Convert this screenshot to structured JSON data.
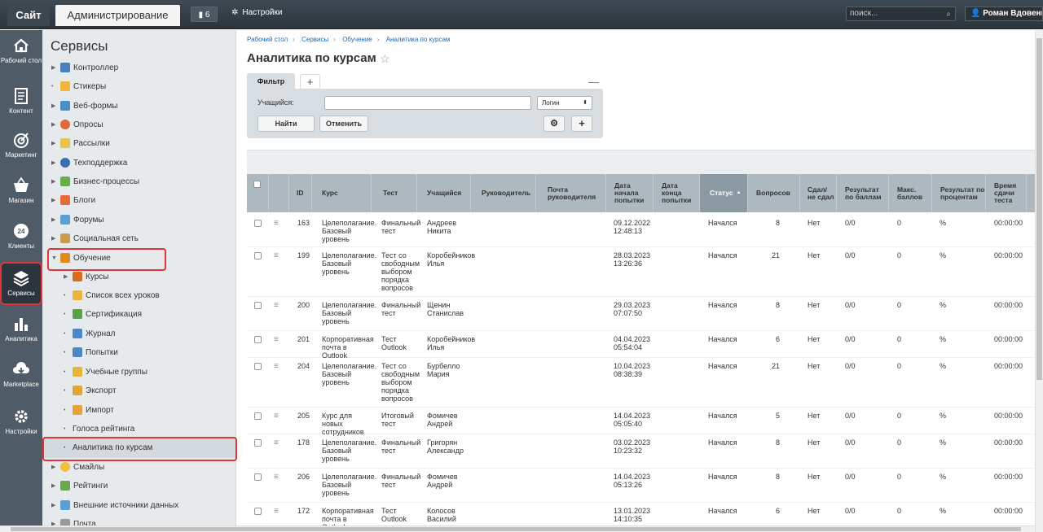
{
  "topbar": {
    "site_tab": "Сайт",
    "admin_tab": "Администрирование",
    "notifications_count": "6",
    "settings_label": "Настройки",
    "search_placeholder": "поиск...",
    "user_name": "Роман Вдовенко"
  },
  "leftnav": [
    {
      "label": "Рабочий стол",
      "icon": "home-icon"
    },
    {
      "label": "Контент",
      "icon": "document-icon"
    },
    {
      "label": "Маркетинг",
      "icon": "target-icon"
    },
    {
      "label": "Магазин",
      "icon": "cart-icon"
    },
    {
      "label": "Клиенты",
      "icon": "clients-icon"
    },
    {
      "label": "Сервисы",
      "icon": "layers-icon"
    },
    {
      "label": "Аналитика",
      "icon": "bar-chart-icon"
    },
    {
      "label": "Marketplace",
      "icon": "cloud-download-icon"
    },
    {
      "label": "Настройки",
      "icon": "gear-icon"
    }
  ],
  "tree": {
    "title": "Сервисы",
    "items": [
      {
        "label": "Контроллер",
        "color": "#4a7fc1"
      },
      {
        "label": "Стикеры",
        "color": "#f2b53c"
      },
      {
        "label": "Веб-формы",
        "color": "#4a90c8"
      },
      {
        "label": "Опросы",
        "color": "#e0693a"
      },
      {
        "label": "Рассылки",
        "color": "#e3c452"
      },
      {
        "label": "Техподдержка",
        "color": "#3b6fb5"
      },
      {
        "label": "Бизнес-процессы",
        "color": "#6ba84f"
      },
      {
        "label": "Блоги",
        "color": "#e56a3a"
      },
      {
        "label": "Форумы",
        "color": "#5c9fd5"
      },
      {
        "label": "Социальная сеть",
        "color": "#c79c4f"
      },
      {
        "label": "Обучение",
        "color": "#e08a1e"
      }
    ],
    "sub_items": [
      {
        "label": "Курсы",
        "color": "#d86b1e"
      },
      {
        "label": "Список всех уроков",
        "color": "#e6b53a"
      },
      {
        "label": "Сертификация",
        "color": "#5aa04b"
      },
      {
        "label": "Журнал",
        "color": "#4f86c9"
      },
      {
        "label": "Попытки",
        "color": "#4f86c9"
      },
      {
        "label": "Учебные группы",
        "color": "#e6b53a"
      },
      {
        "label": "Экспорт",
        "color": "#e6a23a"
      },
      {
        "label": "Импорт",
        "color": "#e6a23a"
      },
      {
        "label": "Голоса рейтинга",
        "color": ""
      },
      {
        "label": "Аналитика по курсам",
        "color": ""
      }
    ],
    "items_after": [
      {
        "label": "Смайлы",
        "color": "#f0c23a"
      },
      {
        "label": "Рейтинги",
        "color": "#6ba84f"
      },
      {
        "label": "Внешние источники данных",
        "color": "#5c9fd5"
      },
      {
        "label": "Почта",
        "color": "#999999"
      }
    ]
  },
  "breadcrumb": [
    "Рабочий стол",
    "Сервисы",
    "Обучение",
    "Аналитика по курсам"
  ],
  "page_title": "Аналитика по курсам",
  "filter": {
    "tab_label": "Фильтр",
    "student_label": "Учащийся:",
    "student_value": "",
    "select_value": "Логин",
    "find_button": "Найти",
    "cancel_button": "Отменить"
  },
  "table": {
    "headers": [
      "ID",
      "Курс",
      "Тест",
      "Учащийся",
      "Руководитель",
      "Почта руководителя",
      "Дата начала попытки",
      "Дата конца попытки",
      "Статус",
      "Вопросов",
      "Сдал/ не сдал",
      "Результат по баллам",
      "Макс. баллов",
      "Результат по процентам",
      "Время сдачи теста"
    ],
    "rows": [
      {
        "id": "163",
        "course": "Целеполагание. Базовый уровень",
        "test": "Финальный тест",
        "student": "Андреев Никита",
        "start": "09.12.2022 12:48:13",
        "status": "Начался",
        "questions": "8",
        "passed": "Нет",
        "score": "0/0",
        "max": "0",
        "percent": "%",
        "time": "00:00:00"
      },
      {
        "id": "199",
        "course": "Целеполагание. Базовый уровень",
        "test": "Тест со свободным выбором порядка вопросов",
        "student": "Коробейников Илья",
        "start": "28.03.2023 13:26:36",
        "status": "Начался",
        "questions": "21",
        "passed": "Нет",
        "score": "0/0",
        "max": "0",
        "percent": "%",
        "time": "00:00:00"
      },
      {
        "id": "200",
        "course": "Целеполагание. Базовый уровень",
        "test": "Финальный тест",
        "student": "Щенин Станислав",
        "start": "29.03.2023 07:07:50",
        "status": "Начался",
        "questions": "8",
        "passed": "Нет",
        "score": "0/0",
        "max": "0",
        "percent": "%",
        "time": "00:00:00"
      },
      {
        "id": "201",
        "course": "Корпоративная почта в Outlook",
        "test": "Тест Outlook",
        "student": "Коробейников Илья",
        "start": "04.04.2023 05:54:04",
        "status": "Начался",
        "questions": "6",
        "passed": "Нет",
        "score": "0/0",
        "max": "0",
        "percent": "%",
        "time": "00:00:00"
      },
      {
        "id": "204",
        "course": "Целеполагание. Базовый уровень",
        "test": "Тест со свободным выбором порядка вопросов",
        "student": "Бурбелло Мария",
        "start": "10.04.2023 08:38:39",
        "status": "Начался",
        "questions": "21",
        "passed": "Нет",
        "score": "0/0",
        "max": "0",
        "percent": "%",
        "time": "00:00:00"
      },
      {
        "id": "205",
        "course": "Курс для новых сотрудников",
        "test": "Итоговый тест",
        "student": "Фомичев Андрей",
        "start": "14.04.2023 05:05:40",
        "status": "Начался",
        "questions": "5",
        "passed": "Нет",
        "score": "0/0",
        "max": "0",
        "percent": "%",
        "time": "00:00:00"
      },
      {
        "id": "178",
        "course": "Целеполагание. Базовый уровень",
        "test": "Финальный тест",
        "student": "Григорян Александр",
        "start": "03.02.2023 10:23:32",
        "status": "Начался",
        "questions": "8",
        "passed": "Нет",
        "score": "0/0",
        "max": "0",
        "percent": "%",
        "time": "00:00:00"
      },
      {
        "id": "206",
        "course": "Целеполагание. Базовый уровень",
        "test": "Финальный тест",
        "student": "Фомичев Андрей",
        "start": "14.04.2023 05:13:26",
        "status": "Начался",
        "questions": "8",
        "passed": "Нет",
        "score": "0/0",
        "max": "0",
        "percent": "%",
        "time": "00:00:00"
      },
      {
        "id": "172",
        "course": "Корпоративная почта в Outlook",
        "test": "Тест Outlook",
        "student": "Колосов Василий",
        "start": "13.01.2023 14:10:35",
        "status": "Начался",
        "questions": "6",
        "passed": "Нет",
        "score": "0/0",
        "max": "0",
        "percent": "%",
        "time": "00:00:00"
      }
    ]
  }
}
